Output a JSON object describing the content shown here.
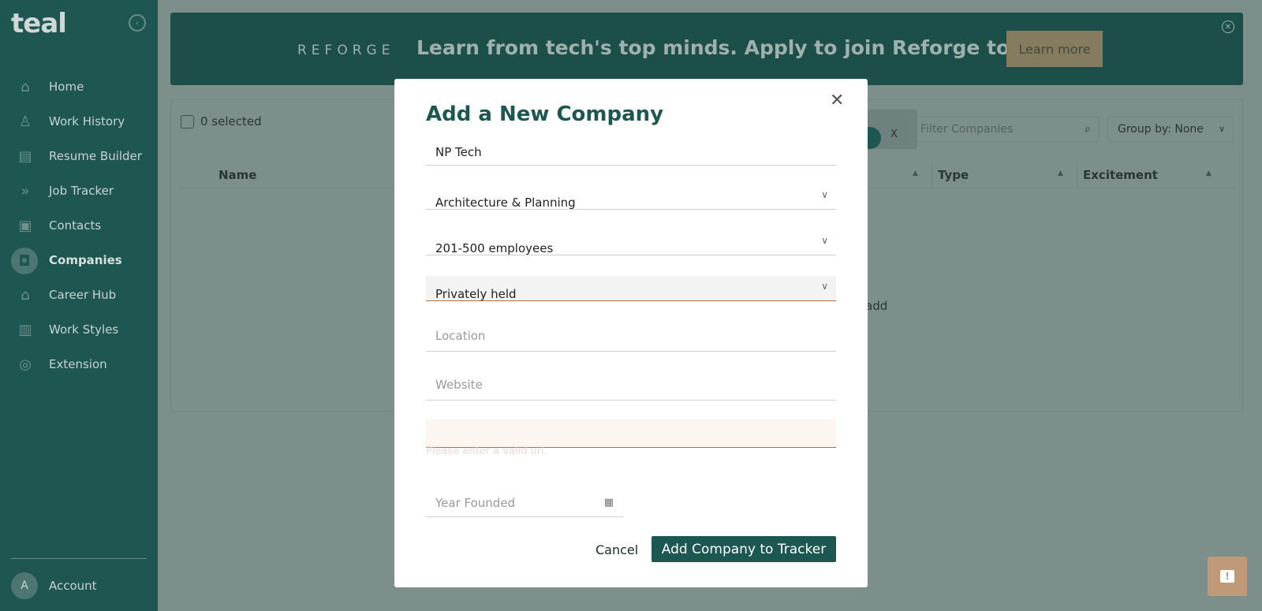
{
  "sidebar": {
    "logo": "teal",
    "items": [
      {
        "label": "Home",
        "icon": "home-icon",
        "glyph": "⌂",
        "active": false
      },
      {
        "label": "Work History",
        "icon": "person-icon",
        "glyph": "♙",
        "active": false
      },
      {
        "label": "Resume Builder",
        "icon": "document-icon",
        "glyph": "▤",
        "active": false
      },
      {
        "label": "Job Tracker",
        "icon": "chevrons-icon",
        "glyph": "»",
        "active": false
      },
      {
        "label": "Contacts",
        "icon": "contact-card-icon",
        "glyph": "▣",
        "active": false
      },
      {
        "label": "Companies",
        "icon": "briefcase-icon",
        "glyph": "◘",
        "active": true
      },
      {
        "label": "Career Hub",
        "icon": "graduation-cap-icon",
        "glyph": "⌂",
        "active": false
      },
      {
        "label": "Work Styles",
        "icon": "bar-chart-icon",
        "glyph": "▥",
        "active": false
      },
      {
        "label": "Extension",
        "icon": "chrome-icon",
        "glyph": "◎",
        "active": false
      }
    ],
    "account": {
      "initial": "A",
      "label": "Account"
    }
  },
  "banner": {
    "brand": "REFORGE",
    "text": "Learn from tech's top minds. Apply to join Reforge today!",
    "button": "Learn more"
  },
  "panel": {
    "selected": "0 selected",
    "chip_close": "X",
    "filter_placeholder": "Filter Companies",
    "group_by": "Group by: None",
    "columns": [
      "Name",
      "Type",
      "Excitement"
    ],
    "empty_text_fragment": "add"
  },
  "modal": {
    "title": "Add a New Company",
    "name_value": "NP Tech",
    "industry": "Architecture & Planning",
    "size": "201-500 employees",
    "type": "Privately held",
    "location_placeholder": "Location",
    "website_placeholder": "Website",
    "error_message": "Please enter a valid url.",
    "year_placeholder": "Year Founded",
    "cancel": "Cancel",
    "submit": "Add Company to Tracker"
  },
  "colors": {
    "sidebar_bg": "#1e5651",
    "accent": "#1d5752",
    "banner_button": "#857c60",
    "error": "#b5703a"
  }
}
